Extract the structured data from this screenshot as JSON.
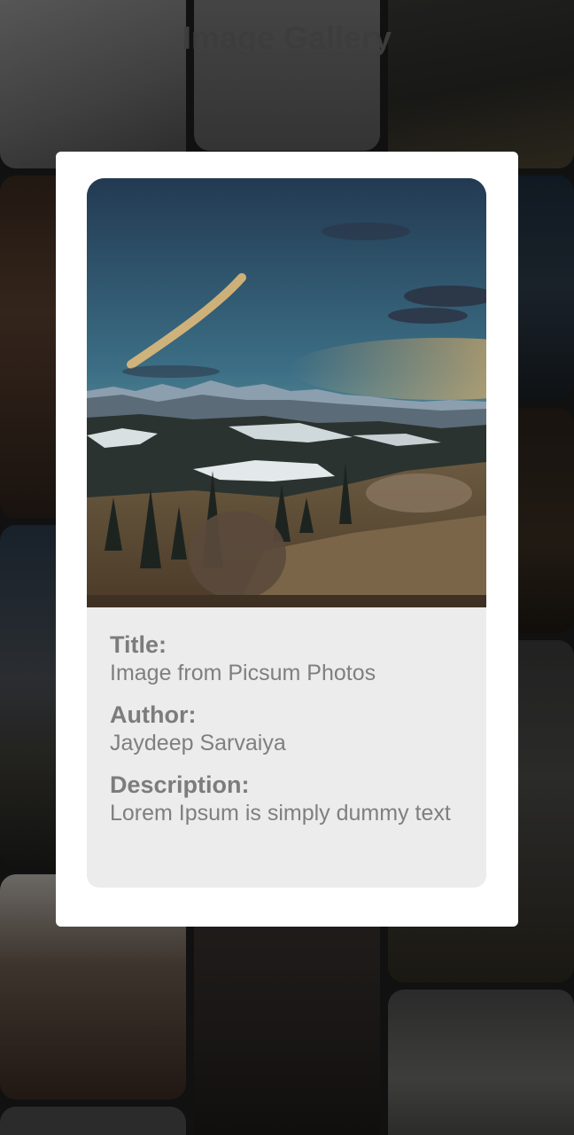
{
  "app": {
    "title": "Image Gallery"
  },
  "dialog": {
    "title_label": "Title:",
    "title_value": "Image from Picsum Photos",
    "author_label": "Author:",
    "author_value": "Jaydeep Sarvaiya",
    "description_label": "Description:",
    "description_value": "Lorem Ipsum is simply dummy text"
  },
  "colors": {
    "dialog_background": "#ffffff",
    "info_background": "#ececec",
    "text": "#7f7f7f",
    "scrim": "rgba(0,0,0,0.42)"
  },
  "icons": []
}
